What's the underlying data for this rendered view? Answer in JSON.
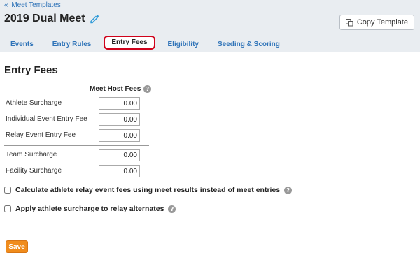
{
  "breadcrumb": {
    "separator": "«",
    "link": "Meet Templates"
  },
  "header": {
    "title": "2019 Dual Meet",
    "edit_icon": "pencil-icon",
    "copy_button": "Copy Template",
    "copy_icon": "copy-icon"
  },
  "tabs": [
    {
      "label": "Events",
      "active": false
    },
    {
      "label": "Entry Rules",
      "active": false
    },
    {
      "label": "Entry Fees",
      "active": true
    },
    {
      "label": "Eligibility",
      "active": false
    },
    {
      "label": "Seeding & Scoring",
      "active": false
    }
  ],
  "section": {
    "title": "Entry Fees",
    "column_header": "Meet Host Fees",
    "help_icon": "?"
  },
  "fees": [
    {
      "label": "Athlete Surcharge",
      "value": "0.00"
    },
    {
      "label": "Individual Event Entry Fee",
      "value": "0.00"
    },
    {
      "label": "Relay Event Entry Fee",
      "value": "0.00"
    },
    {
      "label": "Team Surcharge",
      "value": "0.00"
    },
    {
      "label": "Facility Surcharge",
      "value": "0.00"
    }
  ],
  "options": [
    {
      "label": "Calculate athlete relay event fees using meet results instead of meet entries",
      "checked": false
    },
    {
      "label": "Apply athlete surcharge to relay alternates",
      "checked": false
    }
  ],
  "save_button": "Save",
  "colors": {
    "link": "#2e73b8",
    "header_bg": "#e9edf1",
    "active_tab_border": "#d0021b",
    "save_bg": "#f08c1c"
  }
}
